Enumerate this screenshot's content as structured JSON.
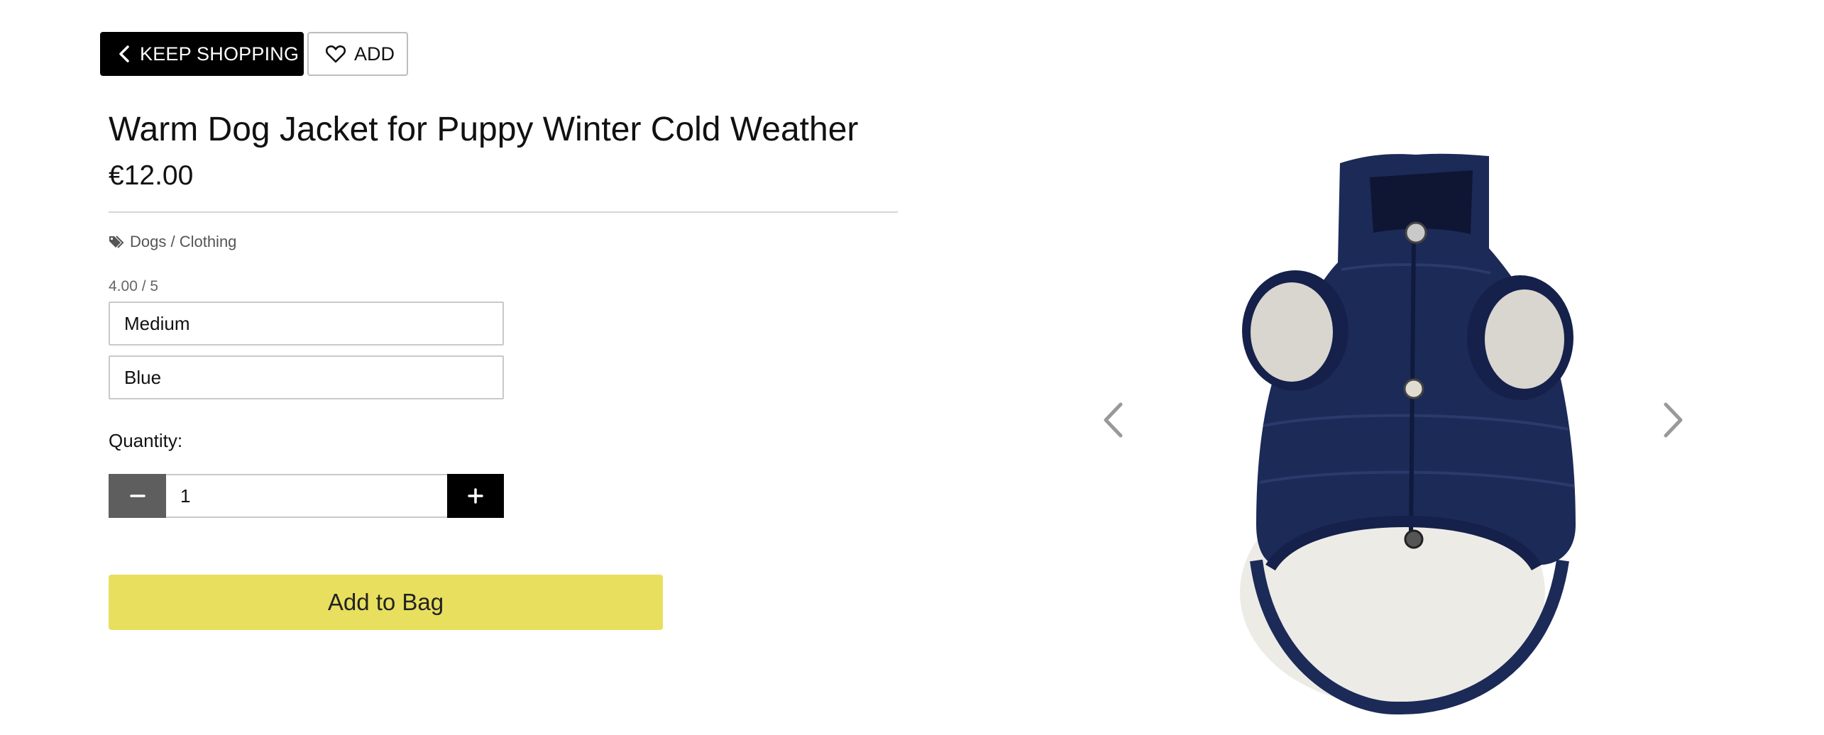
{
  "nav": {
    "keep_shopping_label": "KEEP SHOPPING",
    "wishlist_add_label": "ADD"
  },
  "product": {
    "title": "Warm Dog Jacket for Puppy Winter Cold Weather",
    "price": "€12.00",
    "category": "Dogs / Clothing",
    "rating": "4.00 / 5",
    "size_selected": "Medium",
    "color_selected": "Blue"
  },
  "quantity": {
    "label": "Quantity:",
    "value": "1"
  },
  "actions": {
    "add_to_bag_label": "Add to Bag"
  },
  "colors": {
    "primary_button": "#000000",
    "add_to_bag_bg": "#e8df5e",
    "minus_button": "#5e5e5e",
    "jacket_navy": "#1c2a57"
  },
  "icons": {
    "back": "chevron-left-icon",
    "wishlist": "heart-icon",
    "category": "tags-icon",
    "minus": "minus-icon",
    "plus": "plus-icon",
    "gallery_prev": "chevron-left-icon",
    "gallery_next": "chevron-right-icon"
  }
}
